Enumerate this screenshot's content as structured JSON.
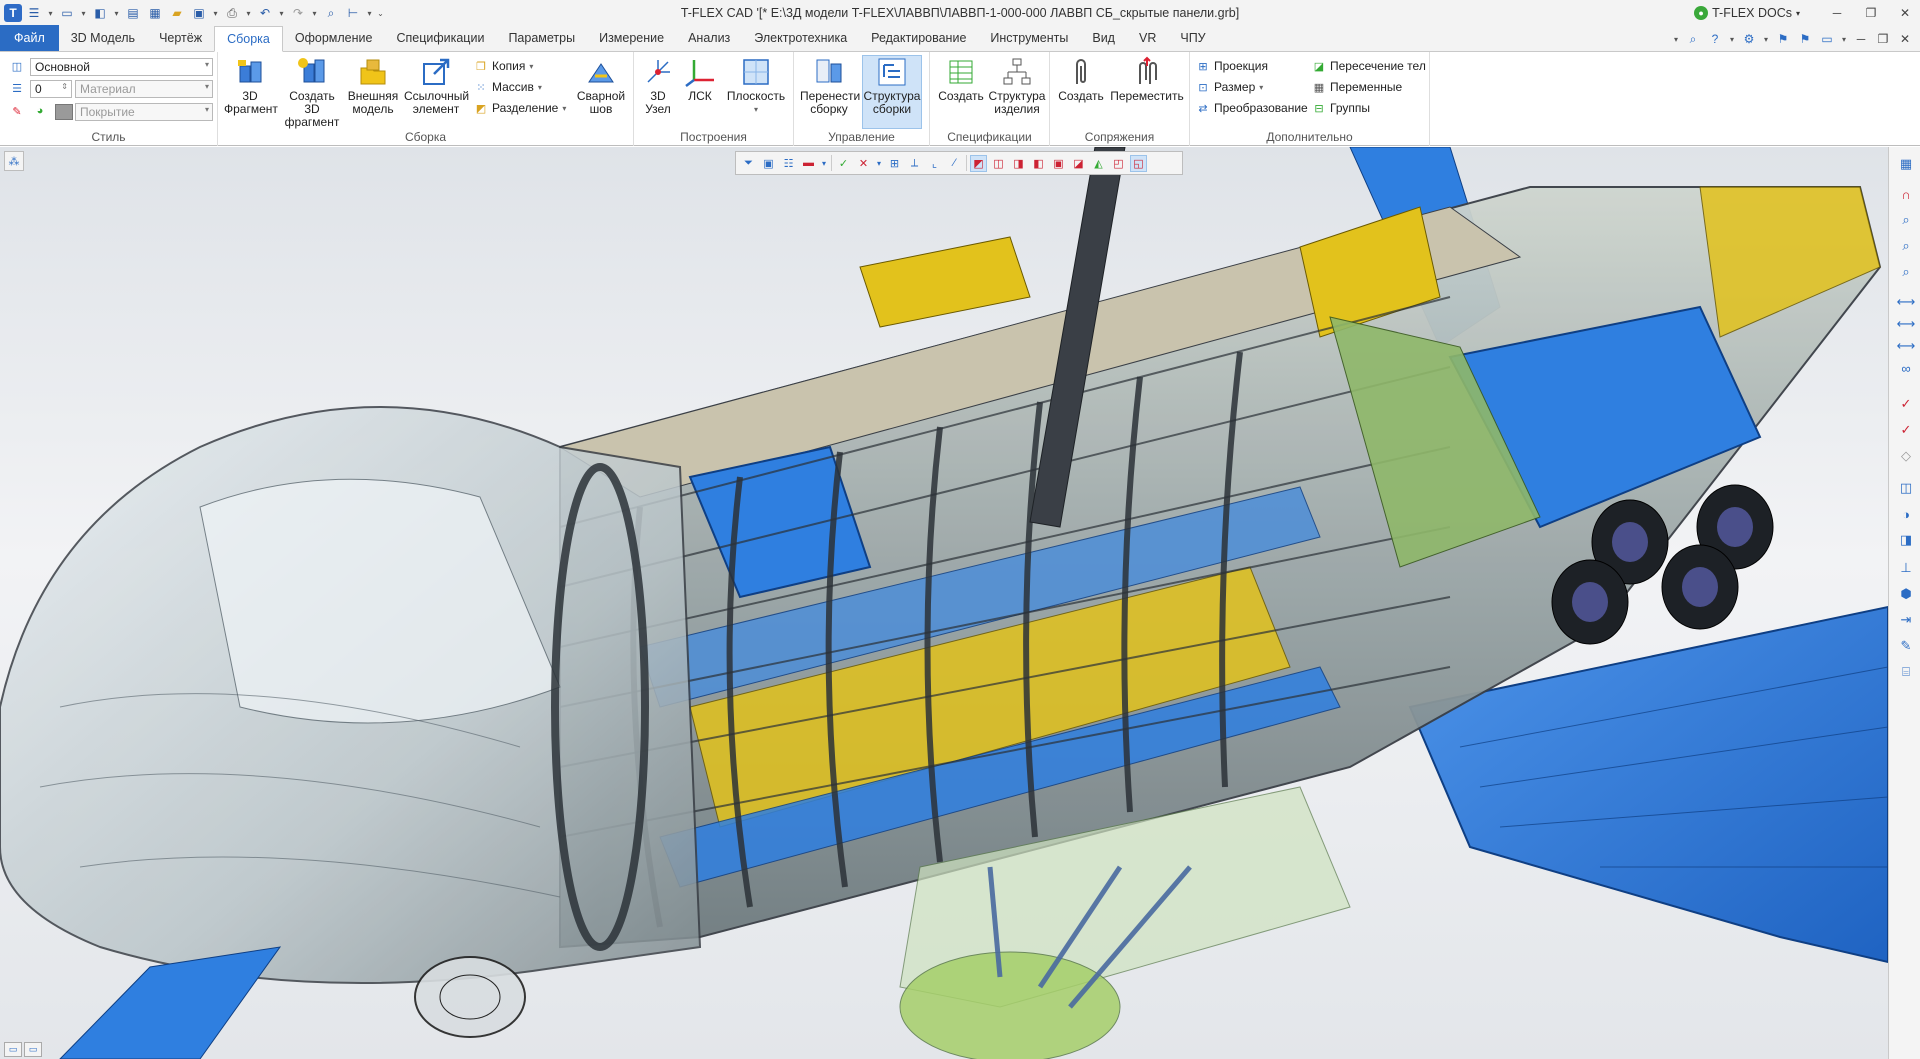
{
  "titlebar": {
    "title": "T-FLEX CAD '[* E:\\3Д модели T-FLEX\\ЛАВВП\\ЛАВВП-1-000-000 ЛАВВП СБ_скрытые панели.grb]",
    "docs_label": "T-FLEX DOCs"
  },
  "tabs": [
    "Файл",
    "3D Модель",
    "Чертёж",
    "Сборка",
    "Оформление",
    "Спецификации",
    "Параметры",
    "Измерение",
    "Анализ",
    "Электротехника",
    "Редактирование",
    "Инструменты",
    "Вид",
    "VR",
    "ЧПУ"
  ],
  "active_tab": "Сборка",
  "style_group": {
    "label": "Стиль",
    "style_value": "Основной",
    "layer_value": "0",
    "material_placeholder": "Материал",
    "coating_placeholder": "Покрытие"
  },
  "assembly_group": {
    "label": "Сборка",
    "btn_fragment_1": "3D",
    "btn_fragment_2": "Фрагмент",
    "btn_create_1": "Создать 3D",
    "btn_create_2": "фрагмент",
    "btn_external_1": "Внешняя",
    "btn_external_2": "модель",
    "btn_ref_1": "Ссылочный",
    "btn_ref_2": "элемент",
    "copy": "Копия",
    "array": "Массив",
    "split": "Разделение",
    "btn_weld_1": "Сварной",
    "btn_weld_2": "шов"
  },
  "build_group": {
    "label": "Построения",
    "btn_node_1": "3D",
    "btn_node_2": "Узел",
    "btn_lcs": "ЛСК",
    "btn_plane": "Плоскость"
  },
  "manage_group": {
    "label": "Управление",
    "btn_move_1": "Перенести",
    "btn_move_2": "сборку",
    "btn_struct_1": "Структура",
    "btn_struct_2": "сборки"
  },
  "spec_group": {
    "label": "Спецификации",
    "btn_create": "Создать",
    "btn_prod_1": "Структура",
    "btn_prod_2": "изделия"
  },
  "mates_group": {
    "label": "Сопряжения",
    "btn_create": "Создать",
    "btn_move": "Переместить"
  },
  "extra_group": {
    "label": "Дополнительно",
    "projection": "Проекция",
    "size": "Размер",
    "transform": "Преобразование",
    "intersection": "Пересечение тел",
    "variables": "Переменные",
    "groups": "Группы"
  },
  "colors": {
    "accent": "#2b6cc4",
    "panel_yellow": "#e2c21c",
    "panel_blue": "#2f7fe0",
    "frame_dark": "#3a3f46"
  }
}
